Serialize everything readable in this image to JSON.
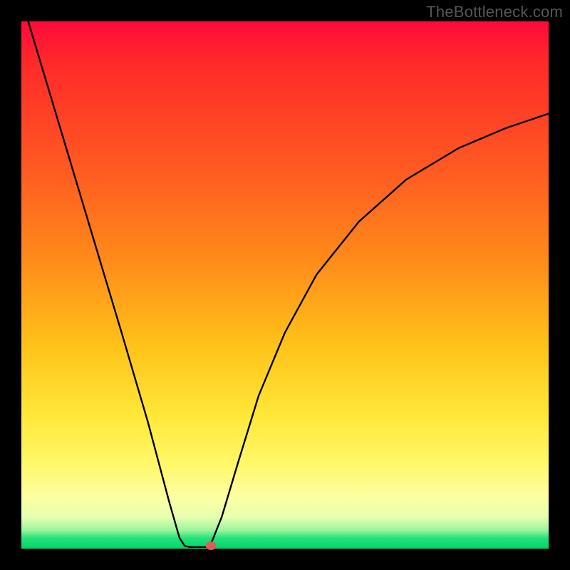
{
  "watermark": "TheBottleneck.com",
  "chart_data": {
    "type": "line",
    "title": "",
    "xlabel": "",
    "ylabel": "",
    "xlim": [
      0,
      1
    ],
    "ylim": [
      0,
      1
    ],
    "background_gradient_stops": [
      {
        "pos": 0.0,
        "color": "#ff0a3a"
      },
      {
        "pos": 0.28,
        "color": "#ff5a22"
      },
      {
        "pos": 0.62,
        "color": "#ffc41a"
      },
      {
        "pos": 0.84,
        "color": "#fff86a"
      },
      {
        "pos": 0.96,
        "color": "#9cf59c"
      },
      {
        "pos": 1.0,
        "color": "#00d36a"
      }
    ],
    "series": [
      {
        "name": "left-branch",
        "x": [
          0.013,
          0.07,
          0.13,
          0.19,
          0.24,
          0.28,
          0.3,
          0.31,
          0.32
        ],
        "y": [
          1.0,
          0.81,
          0.61,
          0.41,
          0.24,
          0.09,
          0.02,
          0.005,
          0.003
        ]
      },
      {
        "name": "valley-floor",
        "x": [
          0.32,
          0.355
        ],
        "y": [
          0.003,
          0.003
        ]
      },
      {
        "name": "right-branch",
        "x": [
          0.36,
          0.38,
          0.41,
          0.45,
          0.5,
          0.56,
          0.64,
          0.73,
          0.83,
          0.92,
          1.0
        ],
        "y": [
          0.01,
          0.06,
          0.16,
          0.29,
          0.41,
          0.52,
          0.62,
          0.7,
          0.76,
          0.798,
          0.825
        ]
      }
    ],
    "marker": {
      "x": 0.36,
      "y": 0.006,
      "color": "#d6605a"
    }
  }
}
